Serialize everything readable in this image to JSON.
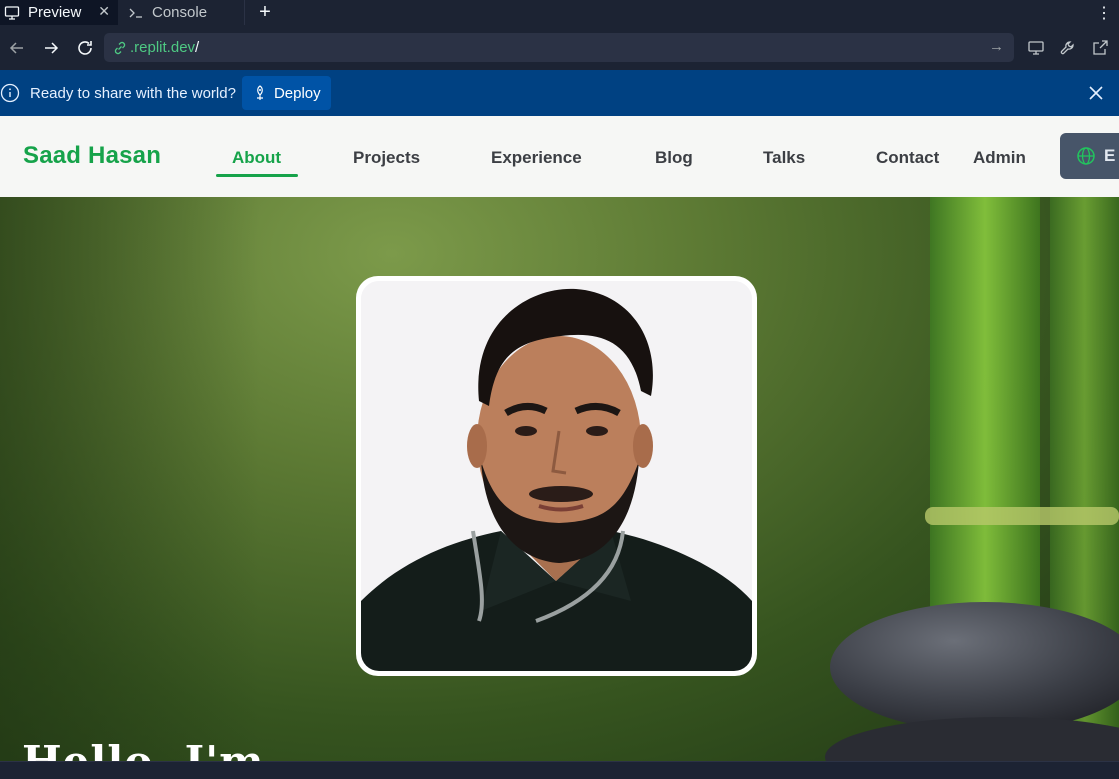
{
  "browser": {
    "tabs": [
      {
        "label": "Preview",
        "icon": "monitor-icon",
        "active": true
      },
      {
        "label": "Console",
        "icon": "terminal-icon",
        "active": false
      }
    ],
    "url": {
      "domain": ".replit.dev",
      "path": "/"
    }
  },
  "banner": {
    "message": "Ready to share with the world?",
    "deploy_label": "Deploy"
  },
  "site": {
    "brand": "Saad Hasan",
    "nav": [
      {
        "label": "About",
        "active": true
      },
      {
        "label": "Projects"
      },
      {
        "label": "Experience"
      },
      {
        "label": "Blog"
      },
      {
        "label": "Talks"
      },
      {
        "label": "Contact"
      },
      {
        "label": "Admin"
      }
    ],
    "lang_label": "E"
  },
  "hero": {
    "title": "Hello, I'm"
  },
  "colors": {
    "accent": "#16a34a",
    "banner_bg": "#004182",
    "ide_bg": "#1c2333"
  }
}
